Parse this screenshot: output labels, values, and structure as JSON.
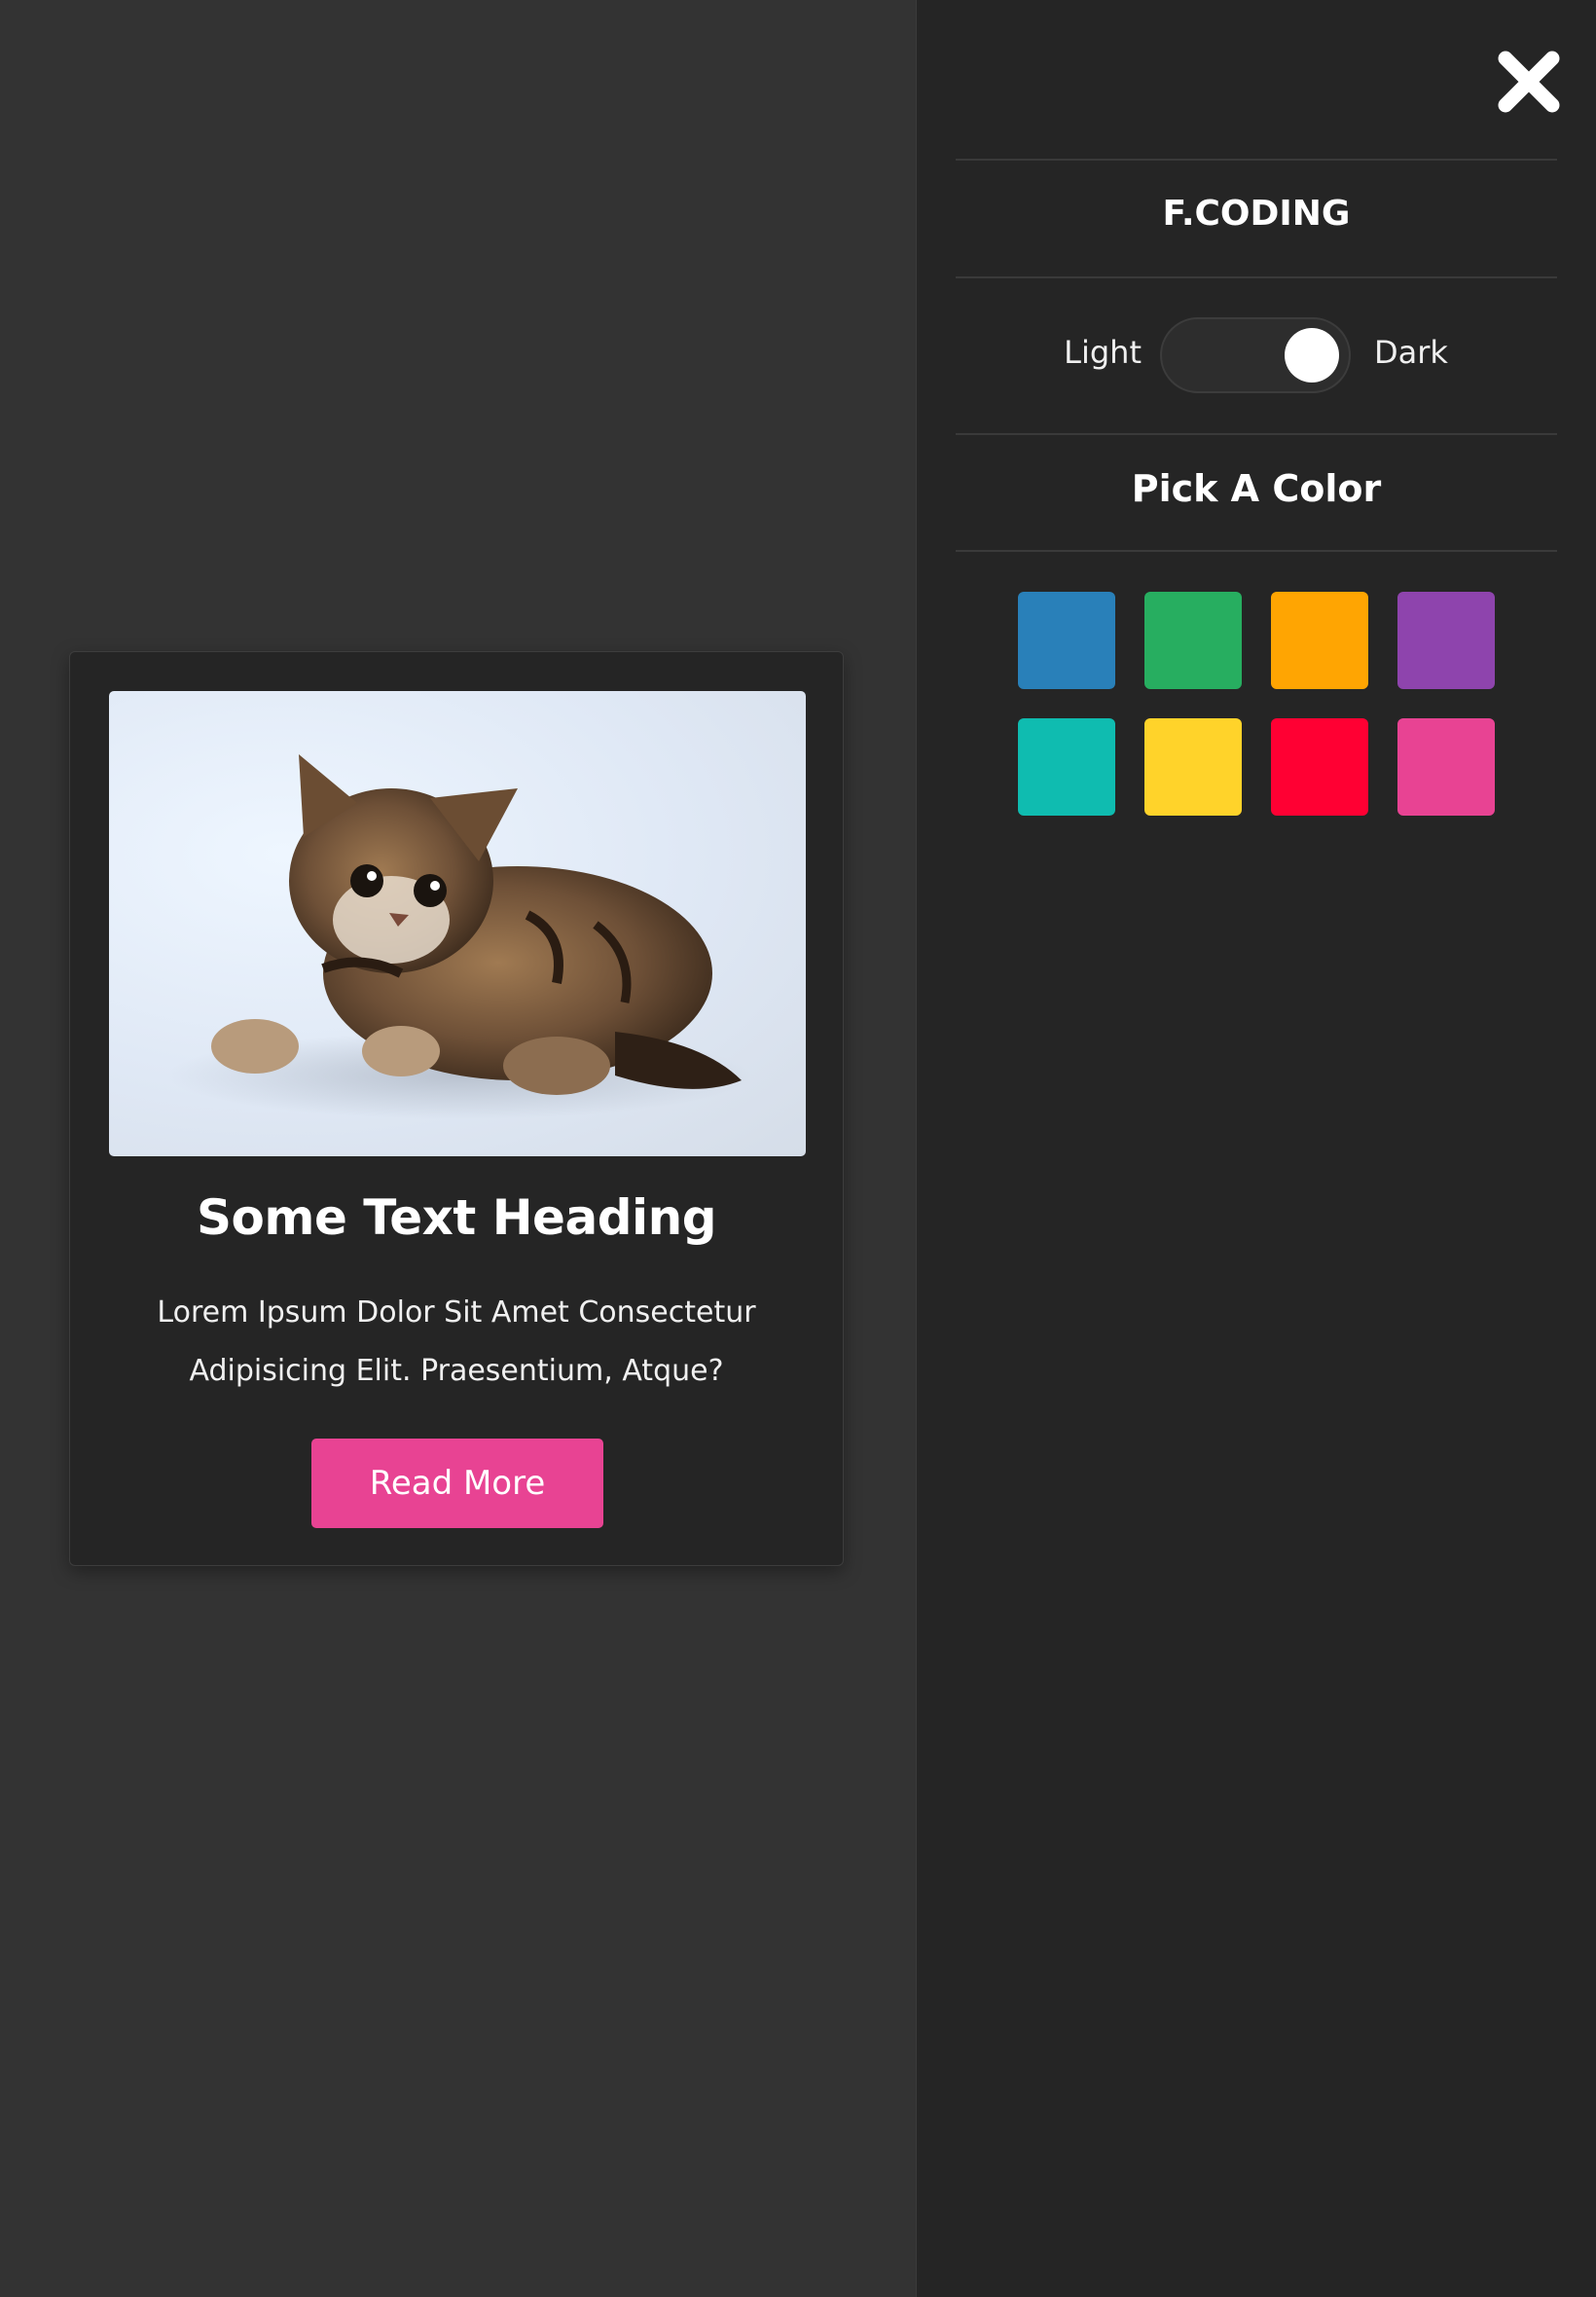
{
  "card": {
    "heading": "Some Text Heading",
    "text": "Lorem Ipsum Dolor Sit Amet Consectetur Adipisicing Elit. Praesentium, Atque?",
    "button_label": "Read More",
    "image_subject": "kitten",
    "accent_color": "#e84393"
  },
  "panel": {
    "close_icon": "close-icon",
    "brand": "F.CODING",
    "theme_toggle": {
      "left_label": "Light",
      "right_label": "Dark",
      "state": "dark"
    },
    "color_picker": {
      "title": "Pick A Color",
      "colors": [
        "#2980b9",
        "#27ae60",
        "#ffa502",
        "#8e44ad",
        "#0fbcb0",
        "#ffd32a",
        "#ff0033",
        "#e84393"
      ]
    }
  },
  "theme": {
    "page_bg": "#333333",
    "panel_bg": "#252525",
    "card_bg": "#252525",
    "text": "#ffffff"
  }
}
